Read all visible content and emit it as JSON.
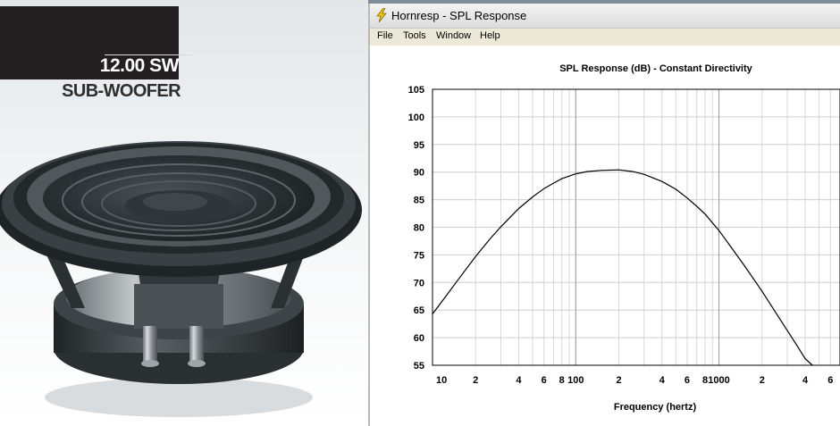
{
  "ad": {
    "model": "12.00 SW",
    "subtitle": "SUB-WOOFER"
  },
  "window": {
    "title": "Hornresp - SPL Response",
    "menu": [
      "File",
      "Tools",
      "Window",
      "Help"
    ]
  },
  "chart_data": {
    "type": "line",
    "title": "SPL Response (dB) - Constant Directivity",
    "xlabel": "Frequency (hertz)",
    "ylabel": "",
    "x_scale": "log",
    "xlim": [
      10,
      7000
    ],
    "ylim": [
      55,
      105
    ],
    "grid": true,
    "yticks": [
      55,
      60,
      65,
      70,
      75,
      80,
      85,
      90,
      95,
      100,
      105
    ],
    "xticks": [
      {
        "value": 10,
        "label": "10"
      },
      {
        "value": 20,
        "label": "2"
      },
      {
        "value": 40,
        "label": "4"
      },
      {
        "value": 60,
        "label": "6"
      },
      {
        "value": 80,
        "label": "8"
      },
      {
        "value": 100,
        "label": "100"
      },
      {
        "value": 200,
        "label": "2"
      },
      {
        "value": 400,
        "label": "4"
      },
      {
        "value": 600,
        "label": "6"
      },
      {
        "value": 800,
        "label": "8"
      },
      {
        "value": 1000,
        "label": "1000"
      },
      {
        "value": 2000,
        "label": "2"
      },
      {
        "value": 4000,
        "label": "4"
      },
      {
        "value": 6000,
        "label": "6"
      }
    ],
    "series": [
      {
        "x": [
          10,
          12,
          15,
          20,
          25,
          30,
          40,
          50,
          60,
          70,
          80,
          100,
          120,
          150,
          200,
          250,
          300,
          400,
          500,
          600,
          700,
          800,
          1000,
          1200,
          1500,
          2000,
          2500,
          3000,
          3500,
          4000,
          4500
        ],
        "y": [
          64.3,
          67,
          70.4,
          74.7,
          77.8,
          80.1,
          83.4,
          85.5,
          87,
          88,
          88.8,
          89.7,
          90.1,
          90.3,
          90.4,
          90.1,
          89.6,
          88.3,
          86.9,
          85.3,
          83.8,
          82.4,
          79.4,
          76.6,
          73.1,
          68.4,
          64.5,
          61.3,
          58.6,
          56.2,
          54.5
        ]
      }
    ]
  }
}
